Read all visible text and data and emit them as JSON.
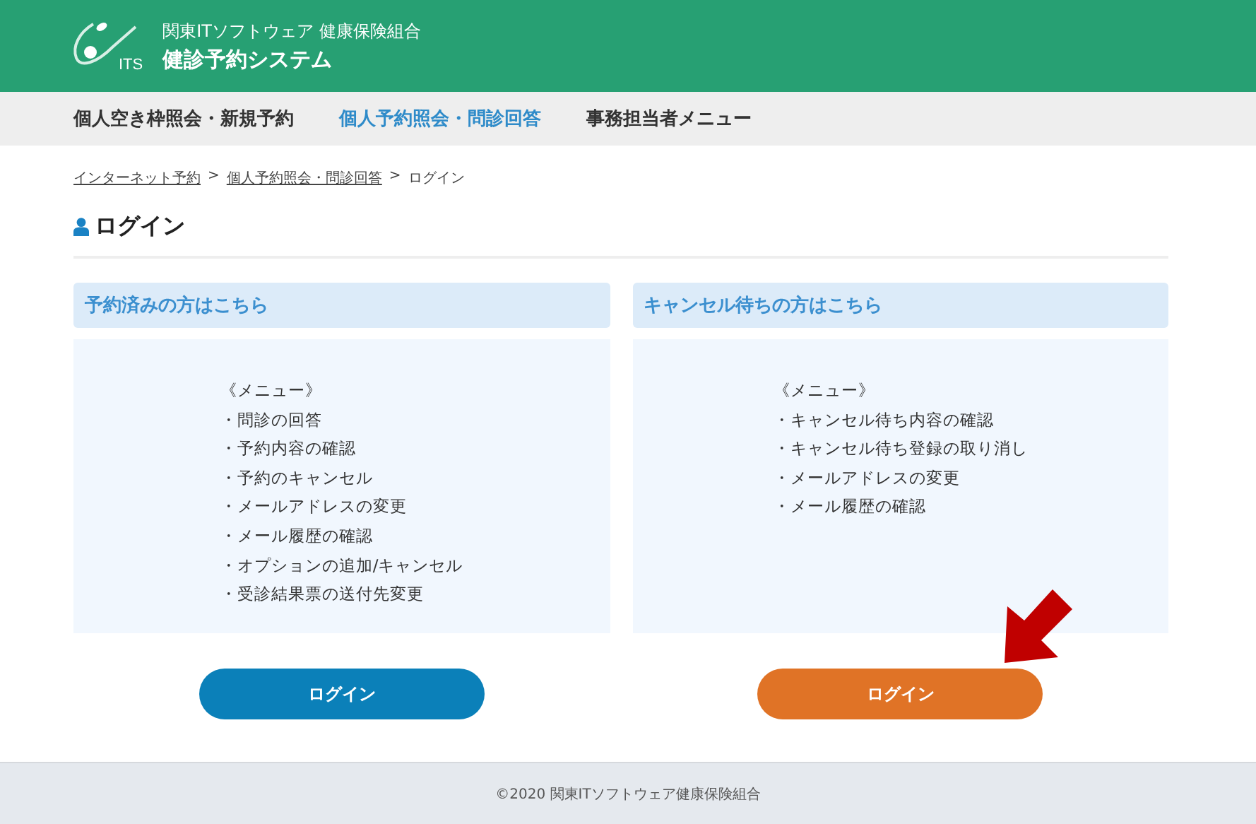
{
  "header": {
    "logo_text": "ITS",
    "org": "関東ITソフトウェア 健康保険組合",
    "system": "健診予約システム"
  },
  "nav": [
    {
      "label": "個人空き枠照会・新規予約",
      "selected": false
    },
    {
      "label": "個人予約照会・問診回答",
      "selected": true
    },
    {
      "label": "事務担当者メニュー",
      "selected": false
    }
  ],
  "breadcrumb": [
    {
      "label": "インターネット予約",
      "link": true
    },
    {
      "label": ">",
      "link": false
    },
    {
      "label": "個人予約照会・問診回答",
      "link": true
    },
    {
      "label": ">",
      "link": false
    },
    {
      "label": "ログイン",
      "link": false
    }
  ],
  "page_title": "ログイン",
  "panels": [
    {
      "title": "予約済みの方はこちら",
      "menu_heading": "《メニュー》",
      "items": [
        "・問診の回答",
        "・予約内容の確認",
        "・予約のキャンセル",
        "・メールアドレスの変更",
        "・メール履歴の確認",
        "・オプションの追加/キャンセル",
        "・受診結果票の送付先変更"
      ],
      "button": {
        "label": "ログイン",
        "kind": "primary"
      }
    },
    {
      "title": "キャンセル待ちの方はこちら",
      "menu_heading": "《メニュー》",
      "items": [
        "・キャンセル待ち内容の確認",
        "・キャンセル待ち登録の取り消し",
        "・メールアドレスの変更",
        "・メール履歴の確認"
      ],
      "button": {
        "label": "ログイン",
        "kind": "waitlist"
      }
    }
  ],
  "footer": "©2020 関東ITソフトウェア健康保険組合"
}
